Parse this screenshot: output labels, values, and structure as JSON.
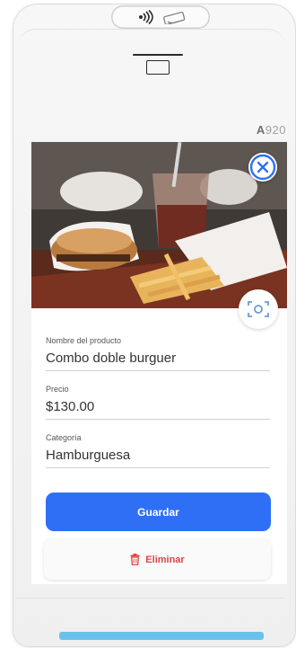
{
  "device": {
    "model_prefix": "A",
    "model_number": "920"
  },
  "form": {
    "product_name_label": "Nombre del producto",
    "product_name_value": "Combo doble burguer",
    "price_label": "Precio",
    "price_value": "$130.00",
    "category_label": "Categoría",
    "category_value": "Hamburguesa"
  },
  "actions": {
    "save_label": "Guardar",
    "delete_label": "Eliminar"
  },
  "colors": {
    "primary": "#2f6ff5",
    "danger": "#e04545",
    "accent_bar": "#6ac2ea"
  },
  "icons": {
    "contactless": "contactless-icon",
    "printer": "printer-icon",
    "close": "close-icon",
    "camera": "camera-icon",
    "trash": "trash-icon"
  }
}
